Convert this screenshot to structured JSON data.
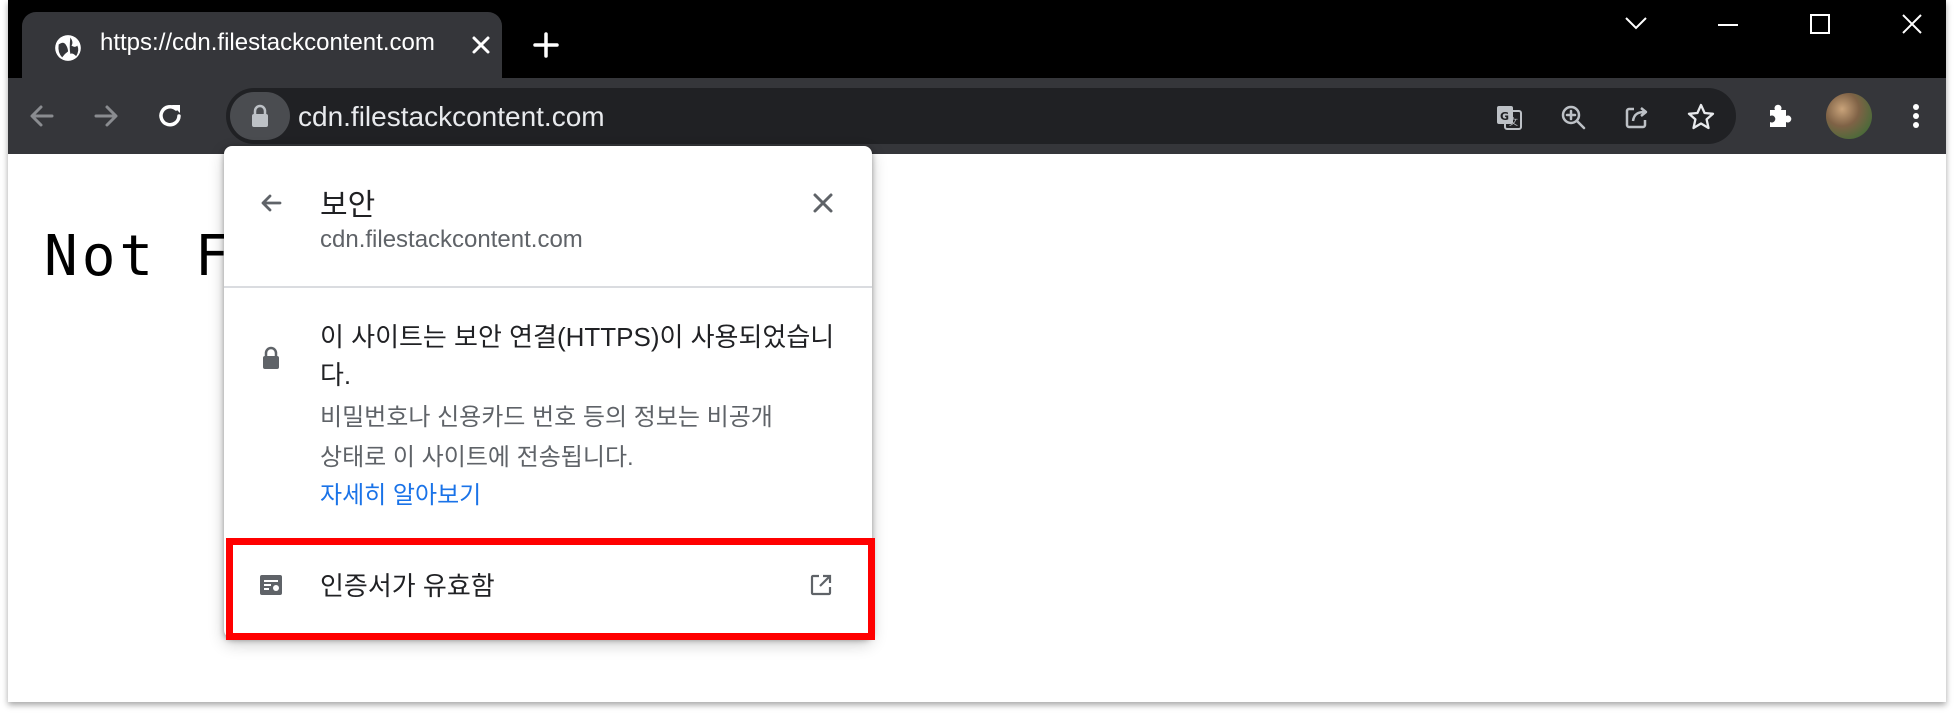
{
  "browser": {
    "tab": {
      "title": "https://cdn.filestackcontent.com",
      "favicon": "globe-icon"
    },
    "window_controls": [
      "chevron-down-icon",
      "minimize-icon",
      "maximize-icon",
      "close-icon"
    ],
    "toolbar": {
      "url": "cdn.filestackcontent.com",
      "icons": [
        "back-arrow-icon",
        "forward-arrow-icon",
        "reload-icon",
        "lock-icon",
        "translate-icon",
        "zoom-icon",
        "share-icon",
        "star-icon",
        "extensions-icon",
        "avatar",
        "menu-icon"
      ]
    }
  },
  "page": {
    "heading": "Not Fo"
  },
  "security_popup": {
    "title": "보안",
    "host": "cdn.filestackcontent.com",
    "secure_message": "이 사이트는 보안 연결(HTTPS)이 사용되었습니다.",
    "detail_line1": "비밀번호나 신용카드 번호 등의 정보는 비공개",
    "detail_line2": "상태로 이 사이트에 전송됩니다.",
    "learn_more": "자세히 알아보기",
    "certificate_label": "인증서가 유효함"
  },
  "colors": {
    "titlebar": "#000000",
    "toolbar": "#35363a",
    "omnibox": "#202124",
    "link": "#1a73e8",
    "highlight": "#ff0000"
  }
}
